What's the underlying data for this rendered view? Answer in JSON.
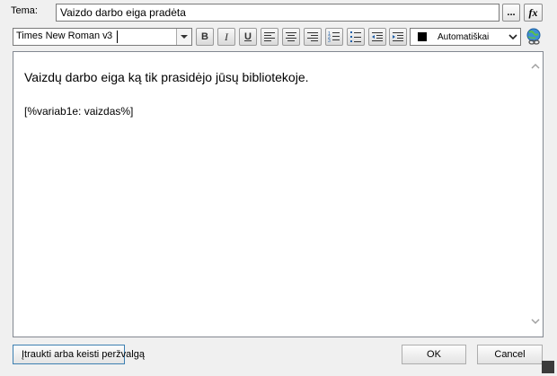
{
  "subject": {
    "label": "Tema:",
    "value": "Vaizdo darbo eiga pradėta",
    "browse_label": "...",
    "formula_label": "fx"
  },
  "toolbar": {
    "font_name": "Times New Roman v",
    "font_size": "3",
    "bold": "B",
    "italic": "I",
    "underline": "U",
    "color_label": "Automatiškai",
    "color_value": "#000000"
  },
  "editor": {
    "body_text": "Vaizdų darbo eiga ką tik prasidėjo jūsų bibliotekoje.",
    "variable_text": "[%variab1e: vaizdas%]"
  },
  "footer": {
    "preview_button": "Įtraukti arba keisti peržvalgą",
    "ok_button": "OK",
    "cancel_button": "Cancel"
  }
}
